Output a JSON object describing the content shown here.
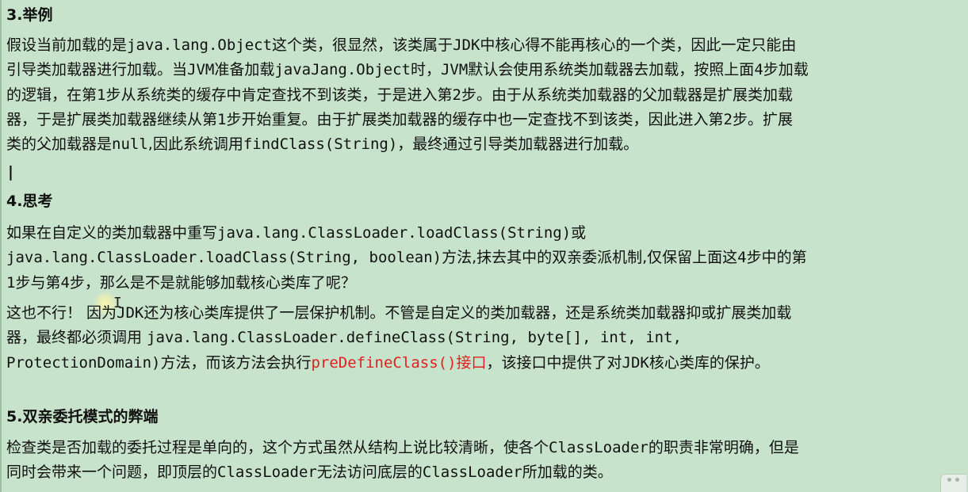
{
  "section3": {
    "heading": "3.举例",
    "lines": [
      [
        "假设当前加载的是",
        "java.lang.Object",
        "这个类，很显然，该类属于",
        "JDK",
        "中核心得不能再核心的一个类，因此一定只能由"
      ],
      [
        "引导类加载器进行加载。当",
        "JVM",
        "准备加载",
        "javaJang.Object",
        "时，",
        "JVM",
        "默认会使用系统类加载器去加载，按照上面",
        "4",
        "步加载"
      ],
      [
        "的逻辑，在第",
        "1",
        "步从系统类的缓存中肯定查找不到该类，于是进入第",
        "2",
        "步。由于从系统类加载器的父加载器是扩展类加载"
      ],
      [
        "器，于是扩展类加载器继续从第",
        "1",
        "步开始重复。由于扩展类加载器的缓存中也一定查找不到该类，因此进入第",
        "2",
        "步。扩展"
      ],
      [
        "类的父加载器是",
        "null",
        ",因此系统调用",
        "findClass(String)",
        "，最终通过引导类加载器进行加载。"
      ]
    ]
  },
  "text_cursor": "|",
  "section4": {
    "heading": "4.思考",
    "question_lines": [
      [
        "如果在自定义的类加载器中重写",
        "java.lang.ClassLoader.loadClass(String)",
        "或"
      ],
      [
        "java.lang.ClassLoader.loadClass(String, boolean)",
        "方法,抹去其中的双亲委派机制,仅保留上面这",
        "4",
        "步中的第"
      ],
      [
        "1",
        "步与第",
        "4",
        "步，那么是不是就能够加载核心类库了呢？"
      ]
    ],
    "answer_lines": [
      [
        "这也不行！  因为",
        "JDK",
        "还为核心类库提供了一层保护机制。不管是自定义的类加载器，还是系统类加载器抑或扩展类加载"
      ],
      [
        "器，最终都必须调用 ",
        "java.lang.ClassLoader.defineClass(String, byte[], int, int,"
      ],
      [
        "ProtectionDomain)",
        "方法，而该方法会执行",
        "preDefineClass()",
        "接口",
        "，该接口中提供了对",
        "JDK",
        "核心类库的保护。"
      ]
    ]
  },
  "section5": {
    "heading": "5.双亲委托模式的弊端",
    "lines": [
      [
        "检查类是否加载的委托过程是单向的，这个方式虽然从结构上说比较清晰，使各个",
        "ClassLoader",
        "的职责非常明确，但是"
      ],
      [
        "同时会带来一个问题，即顶层的",
        "ClassLoader",
        "无法访问底层的",
        "ClassLoader",
        "所加载的类。"
      ]
    ]
  },
  "colors": {
    "background": "#c8e3cb",
    "text": "#111111",
    "highlight_red": "#e02020"
  }
}
